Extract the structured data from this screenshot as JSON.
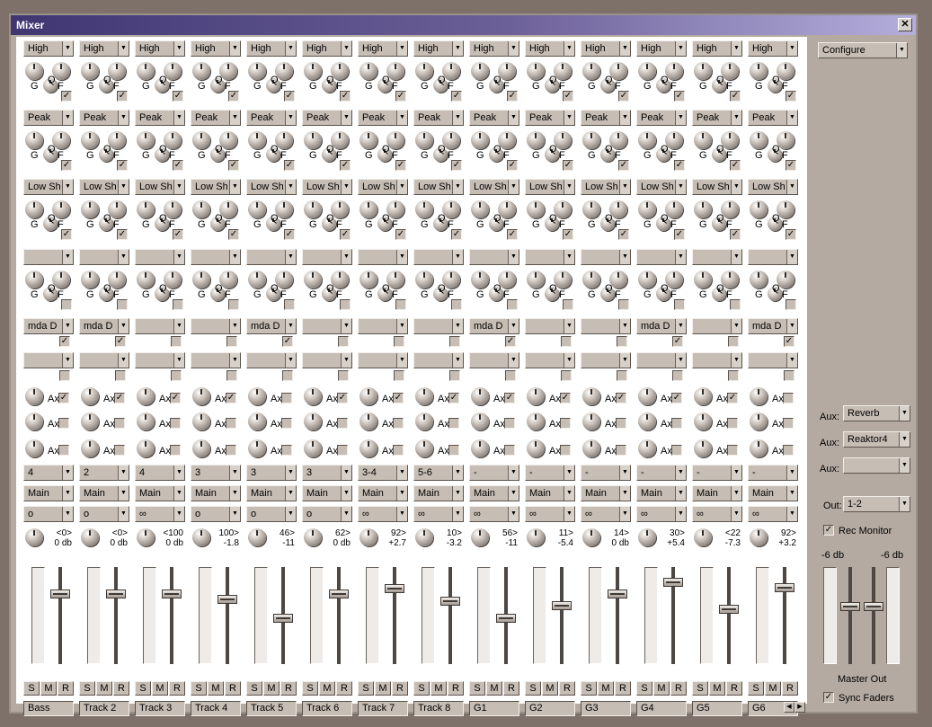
{
  "window": {
    "title": "Mixer",
    "close_label": "✕"
  },
  "eq_labels": {
    "gain": "G",
    "q": "Q",
    "freq": "F"
  },
  "aux_label": "Ax",
  "smr_labels": [
    "S",
    "M",
    "R"
  ],
  "strips": [
    {
      "name": "Bass",
      "eq_bands": [
        "High",
        "Peak",
        "Low Shelf",
        ""
      ],
      "eq_enabled": [
        true,
        true,
        true,
        false
      ],
      "inserts": [
        "mda D",
        ""
      ],
      "insert_enabled": [
        true,
        false
      ],
      "aux_enabled": [
        true,
        false,
        false
      ],
      "input": "4",
      "output": "Main",
      "mode": "o",
      "pan": "<0>",
      "level": "0 db",
      "fader": 0.75
    },
    {
      "name": "Track 2",
      "eq_bands": [
        "High",
        "Peak",
        "Low Shelf",
        ""
      ],
      "eq_enabled": [
        true,
        true,
        true,
        false
      ],
      "inserts": [
        "mda D",
        ""
      ],
      "insert_enabled": [
        true,
        false
      ],
      "aux_enabled": [
        true,
        false,
        false
      ],
      "input": "2",
      "output": "Main",
      "mode": "o",
      "pan": "<0>",
      "level": "0 db",
      "fader": 0.75
    },
    {
      "name": "Track 3",
      "eq_bands": [
        "High",
        "Peak",
        "Low Shelf",
        ""
      ],
      "eq_enabled": [
        true,
        true,
        true,
        false
      ],
      "inserts": [
        "",
        ""
      ],
      "insert_enabled": [
        false,
        false
      ],
      "aux_enabled": [
        true,
        false,
        false
      ],
      "input": "4",
      "output": "Main",
      "mode": "∞",
      "pan": "<100",
      "level": "0 db",
      "fader": 0.75
    },
    {
      "name": "Track 4",
      "eq_bands": [
        "High",
        "Peak",
        "Low Shelf",
        ""
      ],
      "eq_enabled": [
        true,
        true,
        true,
        false
      ],
      "inserts": [
        "",
        ""
      ],
      "insert_enabled": [
        false,
        false
      ],
      "aux_enabled": [
        true,
        false,
        false
      ],
      "input": "3",
      "output": "Main",
      "mode": "o",
      "pan": "100>",
      "level": "-1.8",
      "fader": 0.68
    },
    {
      "name": "Track 5",
      "eq_bands": [
        "High",
        "Peak",
        "Low Shelf",
        ""
      ],
      "eq_enabled": [
        true,
        true,
        true,
        false
      ],
      "inserts": [
        "mda D",
        ""
      ],
      "insert_enabled": [
        true,
        false
      ],
      "aux_enabled": [
        false,
        false,
        false
      ],
      "input": "3",
      "output": "Main",
      "mode": "o",
      "pan": "46>",
      "level": "-11",
      "fader": 0.47
    },
    {
      "name": "Track 6",
      "eq_bands": [
        "High",
        "Peak",
        "Low Shelf",
        ""
      ],
      "eq_enabled": [
        true,
        true,
        true,
        false
      ],
      "inserts": [
        "",
        ""
      ],
      "insert_enabled": [
        false,
        false
      ],
      "aux_enabled": [
        true,
        false,
        false
      ],
      "input": "3",
      "output": "Main",
      "mode": "o",
      "pan": "62>",
      "level": "0 db",
      "fader": 0.75
    },
    {
      "name": "Track 7",
      "eq_bands": [
        "High",
        "Peak",
        "Low Shelf",
        ""
      ],
      "eq_enabled": [
        true,
        true,
        true,
        false
      ],
      "inserts": [
        "",
        ""
      ],
      "insert_enabled": [
        false,
        false
      ],
      "aux_enabled": [
        true,
        false,
        false
      ],
      "input": "3-4",
      "output": "Main",
      "mode": "∞",
      "pan": "92>",
      "level": "+2.7",
      "fader": 0.81
    },
    {
      "name": "Track 8",
      "eq_bands": [
        "High",
        "Peak",
        "Low Shelf",
        ""
      ],
      "eq_enabled": [
        true,
        true,
        true,
        false
      ],
      "inserts": [
        "",
        ""
      ],
      "insert_enabled": [
        false,
        false
      ],
      "aux_enabled": [
        true,
        false,
        false
      ],
      "input": "5-6",
      "output": "Main",
      "mode": "∞",
      "pan": "10>",
      "level": "-3.2",
      "fader": 0.66
    },
    {
      "name": "G1",
      "eq_bands": [
        "High",
        "Peak",
        "Low Shelf",
        ""
      ],
      "eq_enabled": [
        true,
        true,
        true,
        false
      ],
      "inserts": [
        "mda D",
        ""
      ],
      "insert_enabled": [
        true,
        false
      ],
      "aux_enabled": [
        true,
        false,
        false
      ],
      "input": "-",
      "output": "Main",
      "mode": "∞",
      "pan": "56>",
      "level": "-11",
      "fader": 0.47
    },
    {
      "name": "G2",
      "eq_bands": [
        "High",
        "Peak",
        "Low Shelf",
        ""
      ],
      "eq_enabled": [
        true,
        true,
        true,
        false
      ],
      "inserts": [
        "",
        ""
      ],
      "insert_enabled": [
        false,
        false
      ],
      "aux_enabled": [
        true,
        false,
        false
      ],
      "input": "-",
      "output": "Main",
      "mode": "∞",
      "pan": "11>",
      "level": "-5.4",
      "fader": 0.61
    },
    {
      "name": "G3",
      "eq_bands": [
        "High",
        "Peak",
        "Low Shelf",
        ""
      ],
      "eq_enabled": [
        true,
        true,
        true,
        false
      ],
      "inserts": [
        "",
        ""
      ],
      "insert_enabled": [
        false,
        false
      ],
      "aux_enabled": [
        true,
        false,
        false
      ],
      "input": "-",
      "output": "Main",
      "mode": "∞",
      "pan": "14>",
      "level": "0 db",
      "fader": 0.75
    },
    {
      "name": "G4",
      "eq_bands": [
        "High",
        "Peak",
        "Low Shelf",
        ""
      ],
      "eq_enabled": [
        true,
        true,
        true,
        false
      ],
      "inserts": [
        "mda D",
        ""
      ],
      "insert_enabled": [
        true,
        false
      ],
      "aux_enabled": [
        true,
        false,
        false
      ],
      "input": "-",
      "output": "Main",
      "mode": "∞",
      "pan": "30>",
      "level": "+5.4",
      "fader": 0.88
    },
    {
      "name": "G5",
      "eq_bands": [
        "High",
        "Peak",
        "Low Shelf",
        ""
      ],
      "eq_enabled": [
        true,
        true,
        true,
        false
      ],
      "inserts": [
        "",
        ""
      ],
      "insert_enabled": [
        false,
        false
      ],
      "aux_enabled": [
        true,
        false,
        false
      ],
      "input": "-",
      "output": "Main",
      "mode": "∞",
      "pan": "<22",
      "level": "-7.3",
      "fader": 0.57
    },
    {
      "name": "G6",
      "eq_bands": [
        "High",
        "Peak",
        "Low Shelf",
        ""
      ],
      "eq_enabled": [
        true,
        true,
        true,
        false
      ],
      "inserts": [
        "mda D",
        ""
      ],
      "insert_enabled": [
        true,
        false
      ],
      "aux_enabled": [
        false,
        false,
        false
      ],
      "input": "-",
      "output": "Main",
      "mode": "∞",
      "pan": "92>",
      "level": "+3.2",
      "fader": 0.82
    }
  ],
  "right_panel": {
    "configure": "Configure",
    "aux_sends": [
      {
        "label": "Aux:",
        "value": "Reverb"
      },
      {
        "label": "Aux:",
        "value": "Reaktor4"
      },
      {
        "label": "Aux:",
        "value": ""
      }
    ],
    "out_label": "Out:",
    "out_value": "1-2",
    "rec_monitor_label": "Rec Monitor",
    "rec_monitor_checked": true,
    "master_left_db": "-6 db",
    "master_right_db": "-6 db",
    "master_left_fader": 0.6,
    "master_right_fader": 0.6,
    "master_label": "Master Out",
    "sync_faders_label": "Sync Faders",
    "sync_faders_checked": true
  }
}
